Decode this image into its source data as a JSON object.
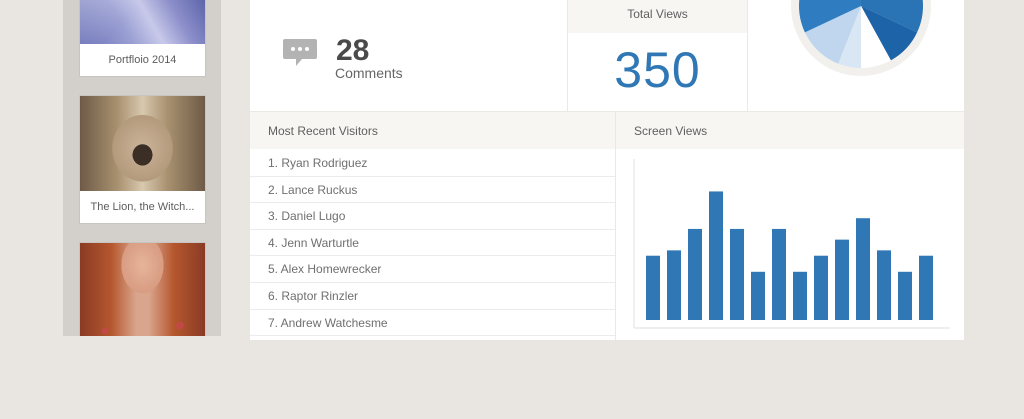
{
  "sidebar": {
    "items": [
      {
        "caption": "Portfloio 2014"
      },
      {
        "caption": "The Lion, the Witch..."
      },
      {
        "caption": ""
      }
    ]
  },
  "comments": {
    "count": "28",
    "label": "Comments"
  },
  "total_views": {
    "label": "Total Views",
    "value": "350"
  },
  "pie": {
    "slices": [
      {
        "value": 32,
        "color": "#2a73b5"
      },
      {
        "value": 10,
        "color": "#1d63a8"
      },
      {
        "value": 8,
        "color": "#ffffff"
      },
      {
        "value": 6,
        "color": "#d9e6f4"
      },
      {
        "value": 12,
        "color": "#bfd6ee"
      },
      {
        "value": 32,
        "color": "#2f7cc0"
      }
    ],
    "ring_color": "#f2f0ec"
  },
  "visitors": {
    "title": "Most Recent Visitors",
    "items": [
      "1. Ryan Rodriguez",
      "2. Lance Ruckus",
      "3. Daniel Lugo",
      "4. Jenn Warturtle",
      "5. Alex Homewrecker",
      "6. Raptor Rinzler",
      "7. Andrew Watchesme"
    ]
  },
  "screen_views": {
    "title": "Screen Views"
  },
  "chart_data": {
    "type": "bar",
    "color": "#2f78b5",
    "values": [
      6,
      6.5,
      8.5,
      12,
      8.5,
      4.5,
      8.5,
      4.5,
      6,
      7.5,
      9.5,
      6.5,
      4.5,
      6
    ],
    "ylim": [
      0,
      14
    ]
  }
}
